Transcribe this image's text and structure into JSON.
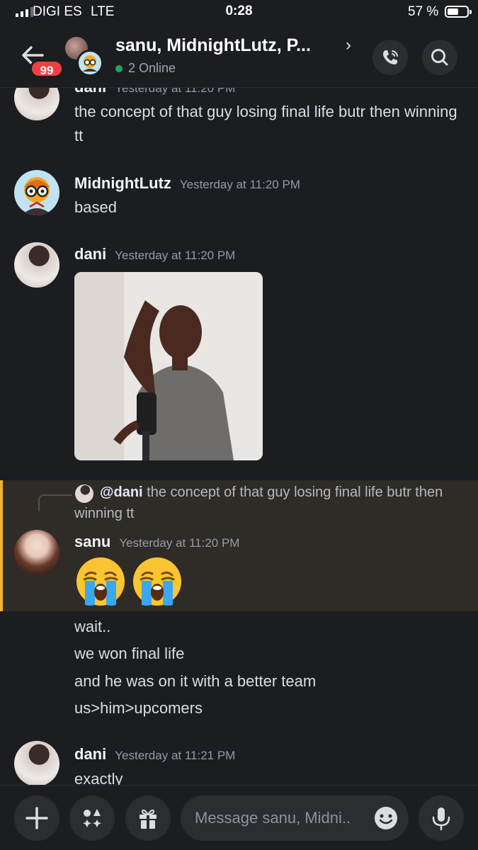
{
  "status_bar": {
    "carrier": "DIGI ES",
    "network": "LTE",
    "time": "0:28",
    "battery_percent": "57 %",
    "battery_level": 0.57
  },
  "header": {
    "back_icon": "arrow-left-icon",
    "unread_badge": "99",
    "title": "sanu, MidnightLutz, P...",
    "chevron": "›",
    "online_status": "2 Online",
    "online_color": "#23a55a",
    "call_icon": "phone-call-icon",
    "search_icon": "search-icon"
  },
  "messages": [
    {
      "author": "dani",
      "timestamp": "Yesterday at 11:20 PM",
      "lines": [
        "the concept of that guy losing final life butr then winning tt"
      ]
    },
    {
      "author": "MidnightLutz",
      "timestamp": "Yesterday at 11:20 PM",
      "lines": [
        "based"
      ]
    },
    {
      "author": "dani",
      "timestamp": "Yesterday at 11:20 PM",
      "attachment": "gif-image"
    },
    {
      "author": "sanu",
      "timestamp": "Yesterday at 11:20 PM",
      "reply_to": {
        "mention": "@dani",
        "text": "the concept of that guy losing final life butr then winning tt"
      },
      "emojis": [
        "loudly-crying-face",
        "loudly-crying-face"
      ],
      "followups": [
        "wait..",
        "we won final life",
        "and he was on it with a better team",
        "us>him>upcomers"
      ]
    },
    {
      "author": "dani",
      "timestamp": "Yesterday at 11:21 PM",
      "lines": [
        "exactly"
      ]
    }
  ],
  "composer": {
    "placeholder": "Message sanu, Midni..",
    "add_icon": "plus-icon",
    "apps_icon": "apps-icon",
    "gift_icon": "gift-icon",
    "emoji_icon": "emoji-face-icon",
    "mic_icon": "microphone-icon"
  },
  "colors": {
    "background": "#1c1d21",
    "highlight": "#2f2c27",
    "highlight_border": "#f0b232",
    "badge": "#f23f42"
  }
}
